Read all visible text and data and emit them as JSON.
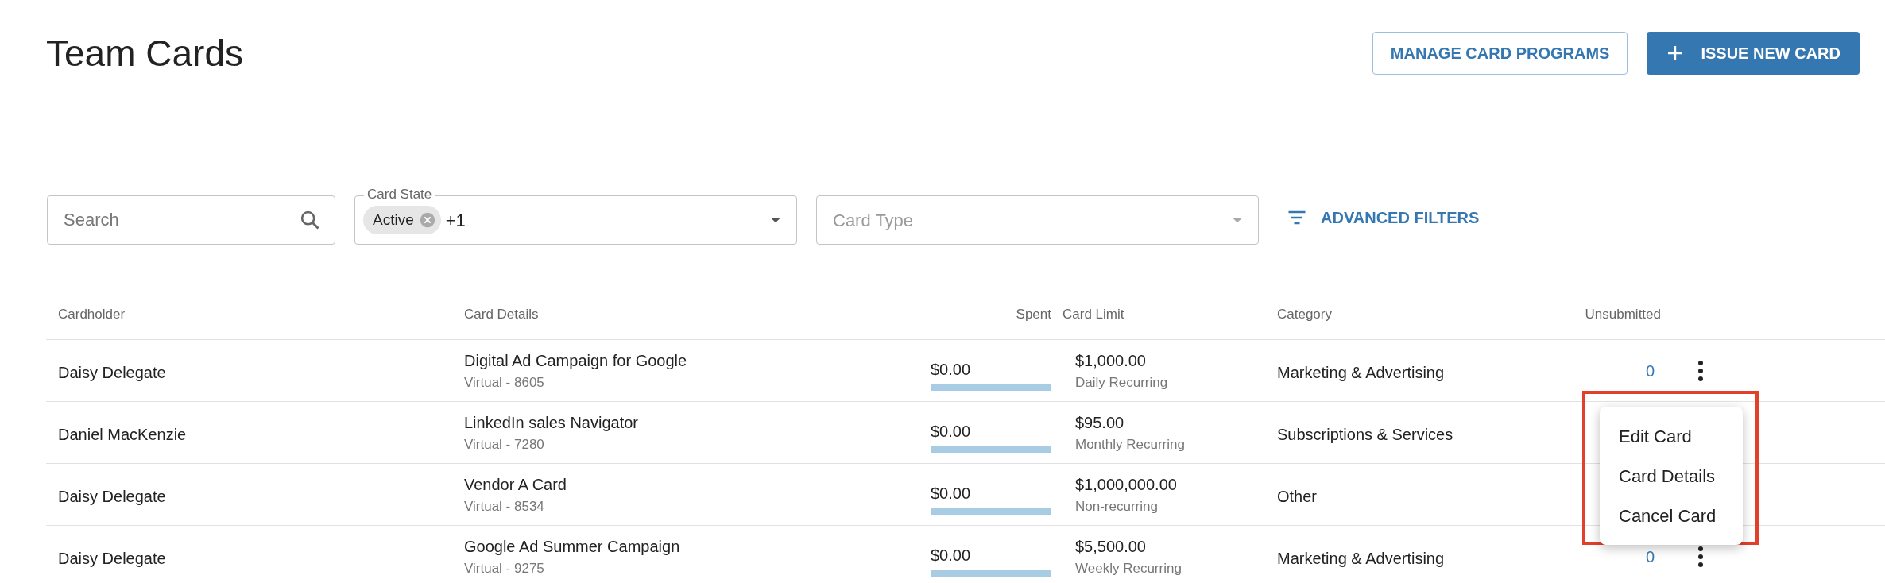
{
  "title": "Team Cards",
  "header_buttons": [
    {
      "kind": "outline",
      "label": "MANAGE CARD PROGRAMS"
    },
    {
      "kind": "primary",
      "label": "ISSUE NEW CARD"
    }
  ],
  "filters": {
    "search": {
      "placeholder": "Search"
    },
    "card_state": {
      "label": "Card State",
      "chips": [
        "Active"
      ],
      "more": "+1"
    },
    "card_type": {
      "placeholder": "Card Type"
    },
    "advanced": "ADVANCED FILTERS"
  },
  "table": {
    "columns": [
      "Cardholder",
      "Card Details",
      "Spent",
      "Card Limit",
      "Category",
      "Unsubmitted"
    ],
    "rows": [
      {
        "cardholder": "Daisy Delegate",
        "card_name": "Digital Ad Campaign for Google",
        "card_sub": "Virtual - 8605",
        "spent": "$0.00",
        "limit": "$1,000.00",
        "limit_sub": "Daily Recurring",
        "category": "Marketing & Advertising",
        "unsubmitted": "0"
      },
      {
        "cardholder": "Daniel MacKenzie",
        "card_name": "LinkedIn sales Navigator",
        "card_sub": "Virtual - 7280",
        "spent": "$0.00",
        "limit": "$95.00",
        "limit_sub": "Monthly Recurring",
        "category": "Subscriptions & Services"
      },
      {
        "cardholder": "Daisy Delegate",
        "card_name": "Vendor A Card",
        "card_sub": "Virtual - 8534",
        "spent": "$0.00",
        "limit": "$1,000,000.00",
        "limit_sub": "Non-recurring",
        "category": "Other"
      },
      {
        "cardholder": "Daisy Delegate",
        "card_name": "Google Ad Summer Campaign",
        "card_sub": "Virtual - 9275",
        "spent": "$0.00",
        "limit": "$5,500.00",
        "limit_sub": "Weekly Recurring",
        "category": "Marketing & Advertising",
        "unsubmitted": "0"
      }
    ]
  },
  "row_menu": {
    "items": [
      "Edit Card",
      "Card Details",
      "Cancel Card"
    ]
  }
}
